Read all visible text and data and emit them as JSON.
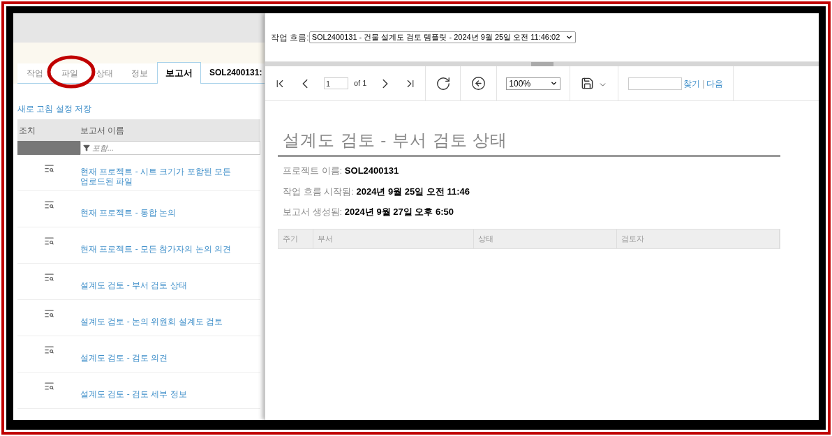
{
  "left_panel": {
    "tabs": [
      {
        "label": "작업",
        "selected": false
      },
      {
        "label": "파일",
        "selected": false
      },
      {
        "label": "상태",
        "selected": false
      },
      {
        "label": "정보",
        "selected": false
      },
      {
        "label": "보고서",
        "selected": true
      }
    ],
    "project_label": "SOL2400131:",
    "save_link": "새로 고침 설정 저장",
    "table": {
      "columns": [
        "조치",
        "보고서 이름"
      ],
      "filter_placeholder": "포함...",
      "rows": [
        {
          "name": "현재 프로젝트 - 시트 크기가 포함된 모든 업로드된 파일"
        },
        {
          "name": "현재 프로젝트 - 통합 논의"
        },
        {
          "name": "현재 프로젝트 - 모든 참가자의 논의 의견"
        },
        {
          "name": "설계도 검토 - 부서 검토 상태"
        },
        {
          "name": "설계도 검토 - 논의 위원회 설계도 검토"
        },
        {
          "name": "설계도 검토 - 검토 의견"
        },
        {
          "name": "설계도 검토 - 검토 세부 정보"
        }
      ]
    }
  },
  "highlight_annotation": true,
  "viewer": {
    "workflow_label": "작업 흐름:",
    "workflow_value": "SOL2400131 - 건물 설계도 검토 템플릿 - 2024년 9월 25일 오전 11:46:02",
    "page": "1",
    "page_of": "of 1",
    "zoom": "100%",
    "find_link": "찾기",
    "link_separator": "|",
    "next_link": "다음",
    "report": {
      "title": "설계도 검토 - 부서 검토 상태",
      "fields": [
        {
          "label": "프로젝트 이름:",
          "value": "SOL2400131"
        },
        {
          "label": "작업 흐름 시작됨:",
          "value": "2024년 9월 25일 오전 11:46"
        },
        {
          "label": "보고서 생성됨:",
          "value": "2024년 9월 27일 오후 6:50"
        }
      ],
      "columns": [
        "주기",
        "부서",
        "상태",
        "검토자"
      ]
    }
  }
}
